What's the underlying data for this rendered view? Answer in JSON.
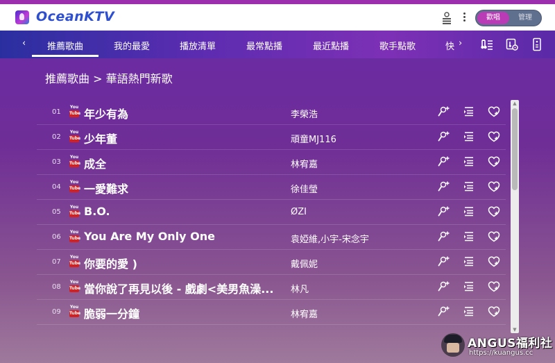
{
  "app": {
    "name": "OceanKTV"
  },
  "header": {
    "mode_toggle": {
      "active_label": "歡唱",
      "inactive_label": "管理"
    }
  },
  "nav": {
    "tabs": [
      {
        "label": "推薦歌曲",
        "active": true
      },
      {
        "label": "我的最愛"
      },
      {
        "label": "播放清單"
      },
      {
        "label": "最常點播"
      },
      {
        "label": "最近點播"
      },
      {
        "label": "歌手點歌"
      },
      {
        "label": "快"
      }
    ],
    "prev_arrow": "‹",
    "next_arrow": "›",
    "icons": [
      "music-list-icon",
      "music-settings-icon",
      "remote-control-icon"
    ]
  },
  "breadcrumb": {
    "text": "推薦歌曲 > 華語熱門新歌"
  },
  "songs": [
    {
      "num": "01",
      "title": "年少有為",
      "artist": "李榮浩"
    },
    {
      "num": "02",
      "title": "少年董",
      "artist": "頑童MJ116"
    },
    {
      "num": "03",
      "title": "成全",
      "artist": "林宥嘉"
    },
    {
      "num": "04",
      "title": "一愛難求",
      "artist": "徐佳瑩"
    },
    {
      "num": "05",
      "title": "B.O.",
      "artist": "ØZI"
    },
    {
      "num": "06",
      "title": "You Are My Only One",
      "artist": "袁婭維,小宇-宋念宇"
    },
    {
      "num": "07",
      "title": "你要的愛 )",
      "artist": "戴佩妮"
    },
    {
      "num": "08",
      "title": "當你說了再見以後 - 戲劇<美男魚澡...",
      "artist": "林凡"
    },
    {
      "num": "09",
      "title": "脆弱一分鐘",
      "artist": "林宥嘉"
    }
  ],
  "source_icon": {
    "top": "You",
    "bottom": "Tube"
  },
  "watermark": {
    "title": "ANGUS福利社",
    "url": "https://kuangus.cc"
  },
  "colors": {
    "accent": "#b93bb5",
    "logo": "#2e4fd0",
    "youtube_red": "#d42020"
  }
}
